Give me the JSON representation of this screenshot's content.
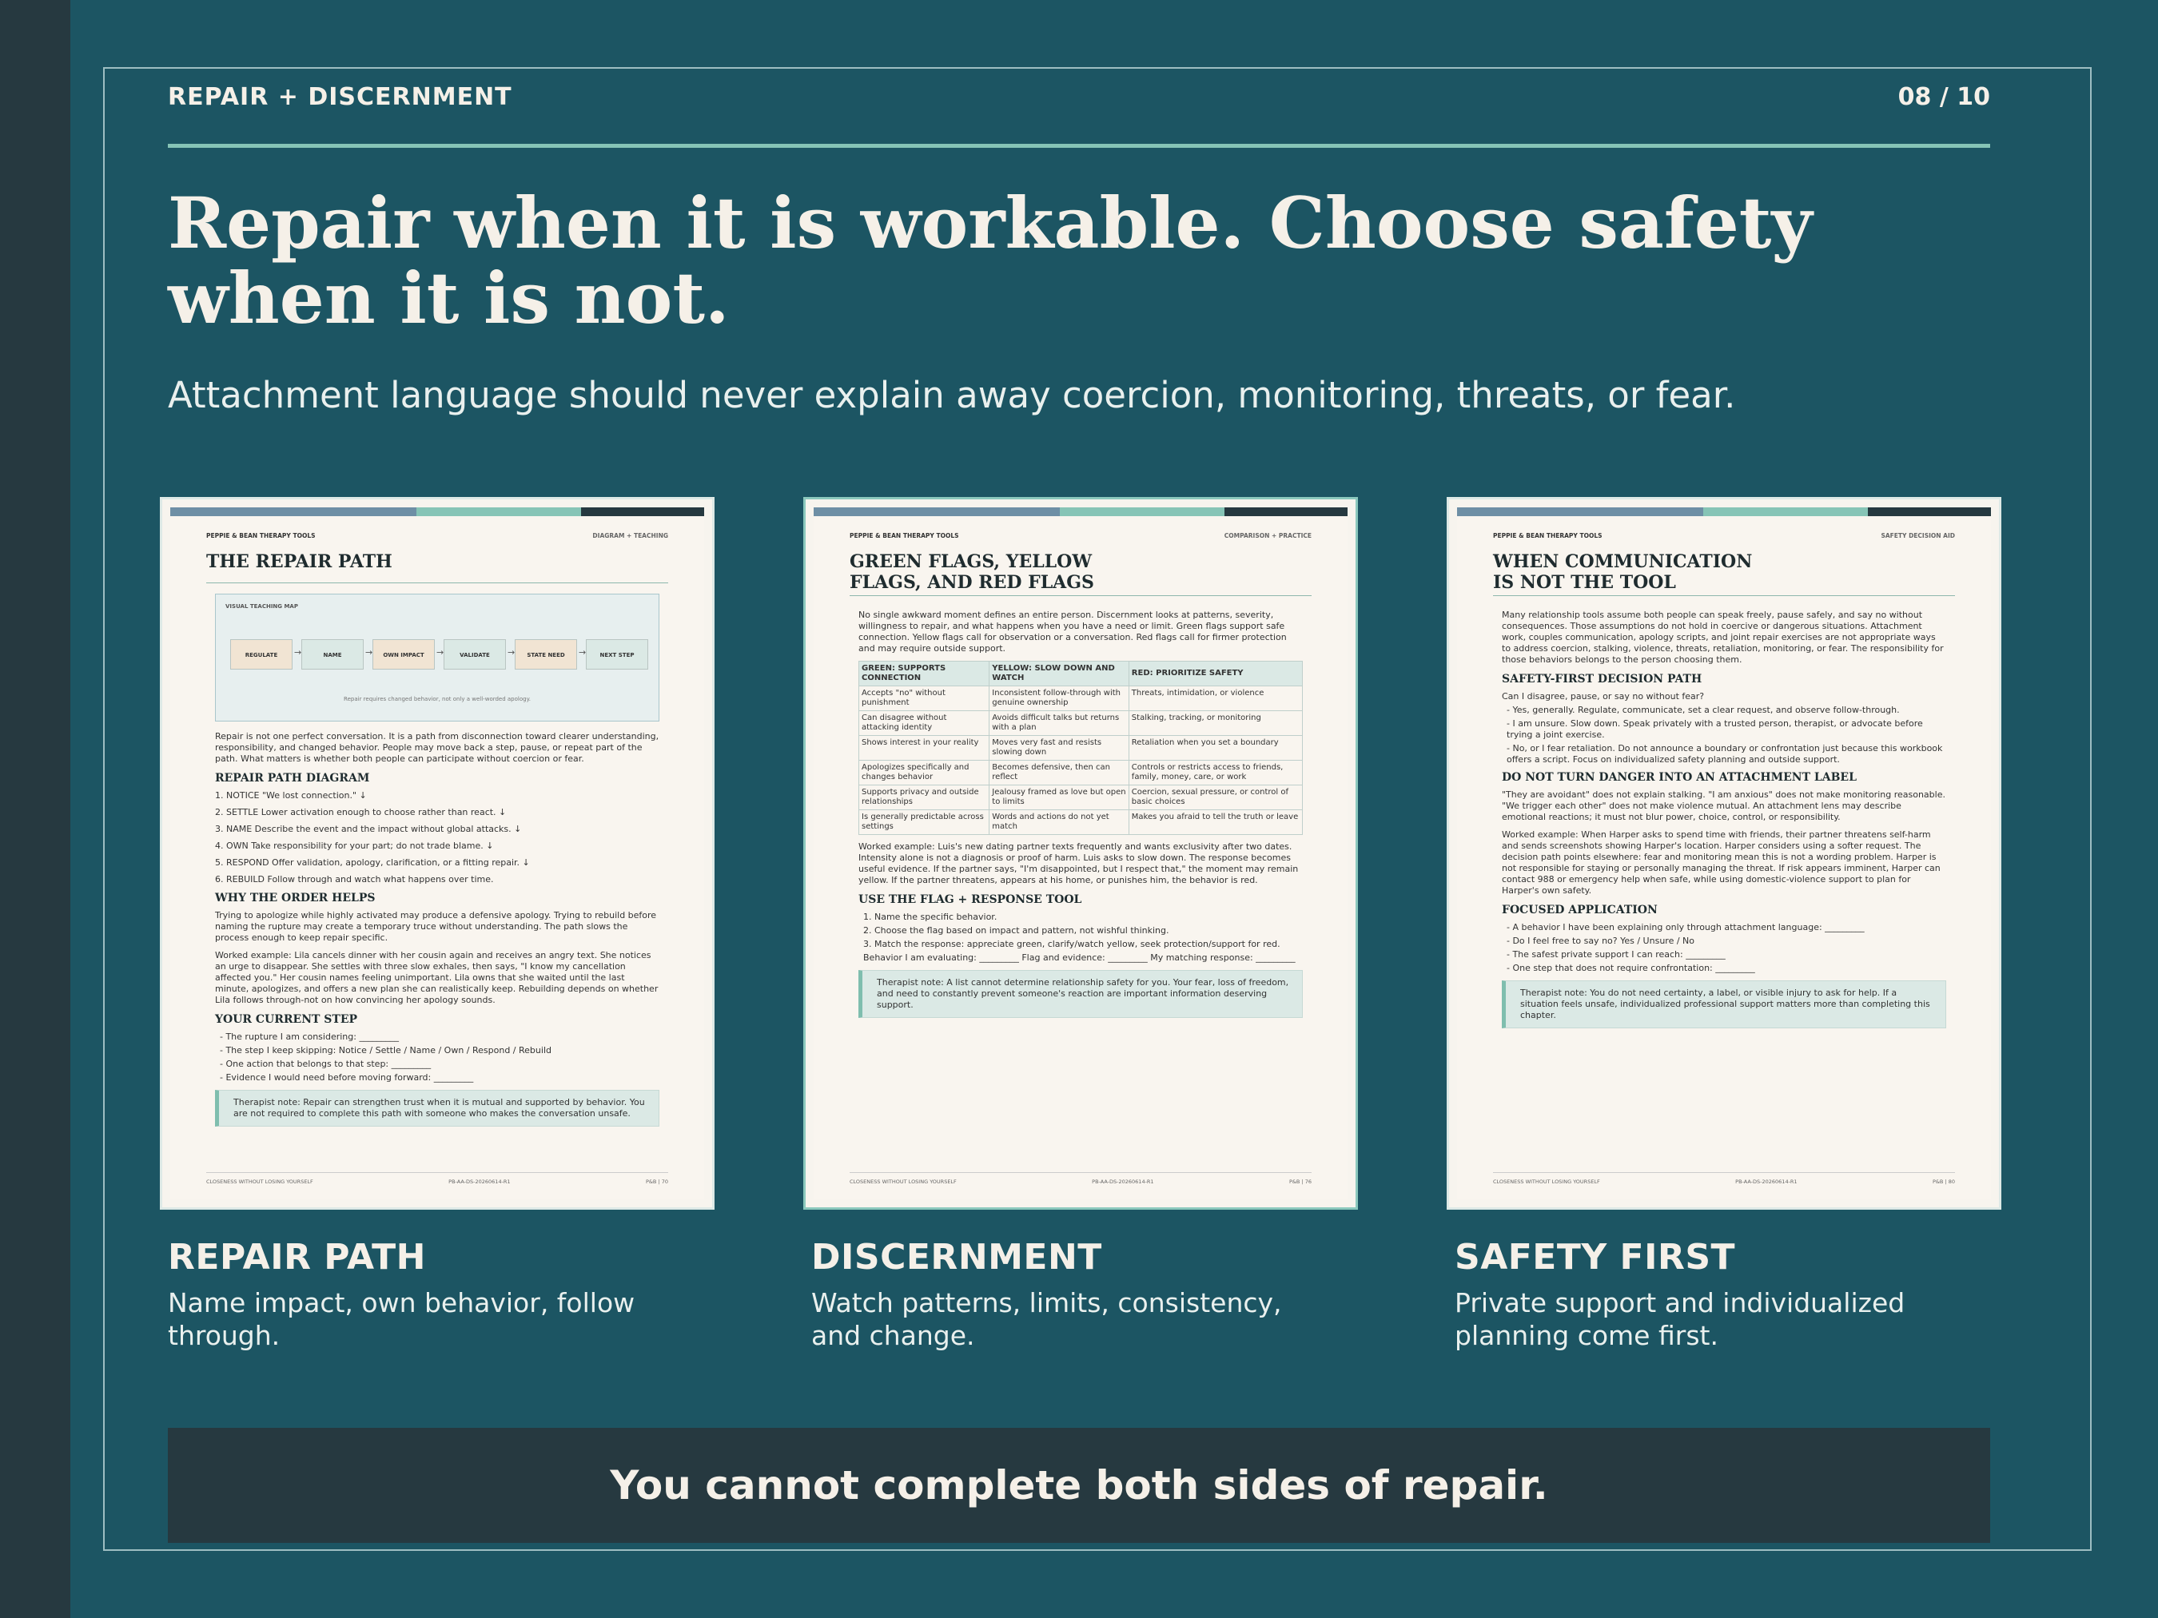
{
  "header": {
    "kicker": "REPAIR + DISCERNMENT",
    "page": "08 / 10"
  },
  "title": "Repair when it is workable. Choose safety when it is not.",
  "subtitle": "Attachment language should never explain away coercion, monitoring, threats, or fear.",
  "colors": {
    "background": "#1c5563",
    "sidebar": "#263940",
    "accent": "#86c4b6",
    "cream": "#f5f0e8",
    "bar_blue": "#6e8fa5",
    "bar_teal": "#86c4b6",
    "bar_dark": "#263940"
  },
  "cards": [
    {
      "heading": "REPAIR PATH",
      "text": "Name impact, own behavior, follow through."
    },
    {
      "heading": "DISCERNMENT",
      "text": "Watch patterns, limits, consistency, and change."
    },
    {
      "heading": "SAFETY FIRST",
      "text": "Private support and individualized planning come first."
    }
  ],
  "banner": "You cannot complete both sides of repair.",
  "docs": {
    "repair": {
      "brand": "PEPPIE & BEAN THERAPY TOOLS",
      "tag": "DIAGRAM + TEACHING",
      "title": "THE REPAIR PATH",
      "map_label": "VISUAL TEACHING MAP",
      "steps": [
        "REGULATE",
        "NAME",
        "OWN IMPACT",
        "VALIDATE",
        "STATE NEED",
        "NEXT STEP"
      ],
      "map_caption": "Repair requires changed behavior, not only a well-worded apology.",
      "intro": "Repair is not one perfect conversation. It is a path from disconnection toward clearer understanding, responsibility, and changed behavior. People may move back a step, pause, or repeat part of the path. What matters is whether both people can participate without coercion or fear.",
      "h_diagram": "REPAIR PATH DIAGRAM",
      "path": [
        "1. NOTICE \"We lost connection.\" ↓",
        "2. SETTLE Lower activation enough to choose rather than react. ↓",
        "3. NAME Describe the event and the impact without global attacks. ↓",
        "4. OWN Take responsibility for your part; do not trade blame. ↓",
        "5. RESPOND Offer validation, apology, clarification, or a fitting repair. ↓",
        "6. REBUILD Follow through and watch what happens over time."
      ],
      "h_why": "WHY THE ORDER HELPS",
      "why": "Trying to apologize while highly activated may produce a defensive apology. Trying to rebuild before naming the rupture may create a temporary truce without understanding. The path slows the process enough to keep repair specific.",
      "example": "Worked example: Lila cancels dinner with her cousin again and receives an angry text. She notices an urge to disappear. She settles with three slow exhales, then says, \"I know my cancellation affected you.\" Her cousin names feeling unimportant. Lila owns that she waited until the last minute, apologizes, and offers a new plan she can realistically keep. Rebuilding depends on whether Lila follows through-not on how convincing her apology sounds.",
      "h_step": "YOUR CURRENT STEP",
      "prompts": [
        "- The rupture I am considering: _________",
        "- The step I keep skipping: Notice / Settle / Name / Own / Respond / Rebuild",
        "- One action that belongs to that step: _________",
        "- Evidence I would need before moving forward: _________"
      ],
      "note": "Therapist note: Repair can strengthen trust when it is mutual and supported by behavior. You are not required to complete this path with someone who makes the conversation unsafe.",
      "footer_left": "CLOSENESS WITHOUT LOSING YOURSELF",
      "footer_mid": "PB-AA-DS-20260614-R1",
      "footer_right": "P&B | 70"
    },
    "flags": {
      "brand": "PEPPIE & BEAN THERAPY TOOLS",
      "tag": "COMPARISON + PRACTICE",
      "title": "GREEN FLAGS, YELLOW FLAGS, AND RED FLAGS",
      "intro": "No single awkward moment defines an entire person. Discernment looks at patterns, severity, willingness to repair, and what happens when you have a need or limit. Green flags support safe connection. Yellow flags call for observation or a conversation. Red flags call for firmer protection and may require outside support.",
      "headers": [
        "GREEN: SUPPORTS CONNECTION",
        "YELLOW: SLOW DOWN AND WATCH",
        "RED: PRIORITIZE SAFETY"
      ],
      "rows": [
        [
          "Accepts \"no\" without punishment",
          "Inconsistent follow-through with genuine ownership",
          "Threats, intimidation, or violence"
        ],
        [
          "Can disagree without attacking identity",
          "Avoids difficult talks but returns with a plan",
          "Stalking, tracking, or monitoring"
        ],
        [
          "Shows interest in your reality",
          "Moves very fast and resists slowing down",
          "Retaliation when you set a boundary"
        ],
        [
          "Apologizes specifically and changes behavior",
          "Becomes defensive, then can reflect",
          "Controls or restricts access to friends, family, money, care, or work"
        ],
        [
          "Supports privacy and outside relationships",
          "Jealousy framed as love but open to limits",
          "Coercion, sexual pressure, or control of basic choices"
        ],
        [
          "Is generally predictable across settings",
          "Words and actions do not yet match",
          "Makes you afraid to tell the truth or leave"
        ]
      ],
      "example": "Worked example: Luis's new dating partner texts frequently and wants exclusivity after two dates. Intensity alone is not a diagnosis or proof of harm. Luis asks to slow down. The response becomes useful evidence. If the partner says, \"I'm disappointed, but I respect that,\" the moment may remain yellow. If the partner threatens, appears at his home, or punishes him, the behavior is red.",
      "h_tool": "USE THE FLAG + RESPONSE TOOL",
      "tool": [
        "1. Name the specific behavior.",
        "2. Choose the flag based on impact and pattern, not wishful thinking.",
        "3. Match the response: appreciate green, clarify/watch yellow, seek protection/support for red."
      ],
      "eval": "Behavior I am evaluating: _________ Flag and evidence: _________ My matching response: _________",
      "note": "Therapist note: A list cannot determine relationship safety for you. Your fear, loss of freedom, and need to constantly prevent someone's reaction are important information deserving support.",
      "footer_left": "CLOSENESS WITHOUT LOSING YOURSELF",
      "footer_mid": "PB-AA-DS-20260614-R1",
      "footer_right": "P&B | 76"
    },
    "safety": {
      "brand": "PEPPIE & BEAN THERAPY TOOLS",
      "tag": "SAFETY DECISION AID",
      "title": "WHEN COMMUNICATION IS NOT THE TOOL",
      "intro": "Many relationship tools assume both people can speak freely, pause safely, and say no without consequences. Those assumptions do not hold in coercive or dangerous situations. Attachment work, couples communication, apology scripts, and joint repair exercises are not appropriate ways to address coercion, stalking, violence, threats, retaliation, monitoring, or fear. The responsibility for those behaviors belongs to the person choosing them.",
      "h_path": "SAFETY-FIRST DECISION PATH",
      "question": "Can I disagree, pause, or say no without fear?",
      "answers": [
        "- Yes, generally. Regulate, communicate, set a clear request, and observe follow-through.",
        "- I am unsure. Slow down. Speak privately with a trusted person, therapist, or advocate before trying a joint exercise.",
        "- No, or I fear retaliation. Do not announce a boundary or confrontation just because this workbook offers a script. Focus on individualized safety planning and outside support."
      ],
      "h_label": "DO NOT TURN DANGER INTO AN ATTACHMENT LABEL",
      "label_text": "\"They are avoidant\" does not explain stalking. \"I am anxious\" does not make monitoring reasonable. \"We trigger each other\" does not make violence mutual. An attachment lens may describe emotional reactions; it must not blur power, choice, control, or responsibility.",
      "example": "Worked example: When Harper asks to spend time with friends, their partner threatens self-harm and sends screenshots showing Harper's location. Harper considers using a softer request. The decision path points elsewhere: fear and monitoring mean this is not a wording problem. Harper is not responsible for staying or personally managing the threat. If risk appears imminent, Harper can contact 988 or emergency help when safe, while using domestic-violence support to plan for Harper's own safety.",
      "h_apply": "FOCUSED APPLICATION",
      "apply": [
        "- A behavior I have been explaining only through attachment language: _________",
        "- Do I feel free to say no? Yes / Unsure / No",
        "- The safest private support I can reach: _________",
        "- One step that does not require confrontation: _________"
      ],
      "note": "Therapist note: You do not need certainty, a label, or visible injury to ask for help. If a situation feels unsafe, individualized professional support matters more than completing this chapter.",
      "footer_left": "CLOSENESS WITHOUT LOSING YOURSELF",
      "footer_mid": "PB-AA-DS-20260614-R1",
      "footer_right": "P&B | 80"
    }
  }
}
